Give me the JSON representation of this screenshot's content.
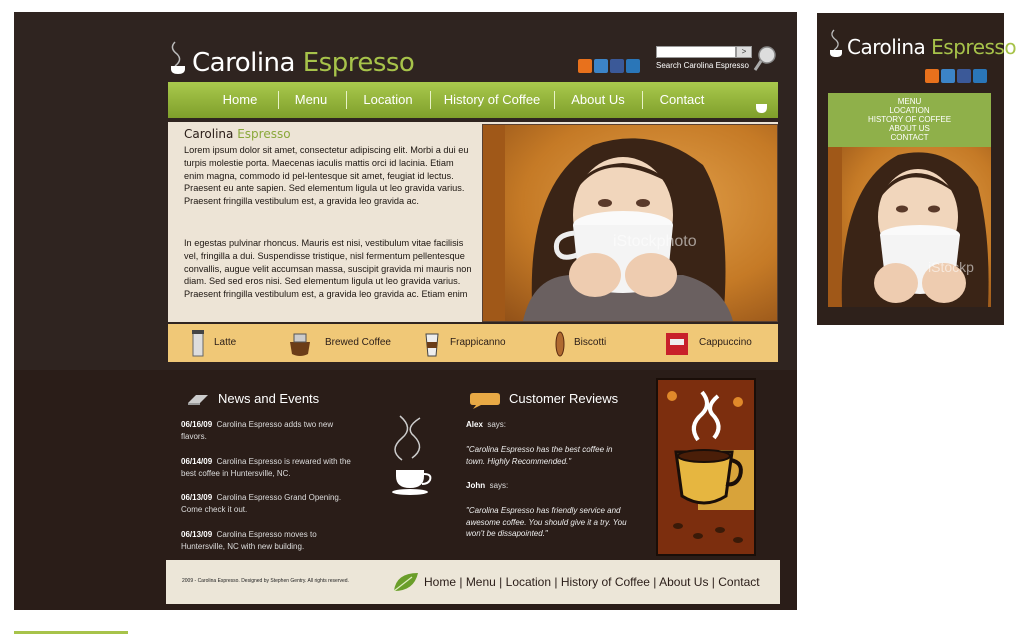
{
  "brand": {
    "name_white": "Carolina",
    "name_green": "Espresso"
  },
  "social": [
    {
      "name": "blogger",
      "color": "#e8711c"
    },
    {
      "name": "stumbleupon",
      "color": "#3c84c7"
    },
    {
      "name": "facebook",
      "color": "#3b5998"
    },
    {
      "name": "digg",
      "color": "#2a76b8"
    }
  ],
  "search": {
    "placeholder": "",
    "button": ">",
    "caption": "Search Carolina Espresso"
  },
  "nav": [
    "Home",
    "Menu",
    "Location",
    "History of Coffee",
    "About Us",
    "Contact"
  ],
  "intro": {
    "title_a": "Carolina",
    "title_b": "Espresso",
    "p1": "Lorem ipsum dolor sit amet, consectetur adipiscing elit. Morbi a dui eu turpis molestie porta. Maecenas iaculis mattis orci id lacinia. Etiam enim magna, commodo id pel-lentesque sit amet, feugiat id lectus. Praesent eu ante sapien. Sed elementum ligula ut leo gravida varius. Praesent fringilla vestibulum est, a gravida leo gravida ac.",
    "p2": "In egestas pulvinar rhoncus. Mauris est nisi, vestibulum vitae facilisis vel, fringilla a dui. Suspendisse tristique, nisl fermentum pellentesque convallis, augue velit accumsan massa, suscipit gravida mi mauris non diam. Sed sed eros nisi.  Sed elementum ligula ut leo gravida varius. Praesent fringilla vestibulum est, a gravida leo gravida ac.  Etiam enim"
  },
  "watermark": "iStockphoto",
  "products": [
    "Latte",
    "Brewed Coffee",
    "Frappicanno",
    "Biscotti",
    "Cappuccino"
  ],
  "news": {
    "title": "News and Events",
    "items": [
      {
        "date": "06/16/09",
        "text": "Carolina Espresso adds two new flavors."
      },
      {
        "date": "06/14/09",
        "text": "Carolina Espresso is rewared with the best coffee in Huntersville, NC."
      },
      {
        "date": "06/13/09",
        "text": "Carolina Espresso Grand Opening. Come check it out."
      },
      {
        "date": "06/13/09",
        "text": "Carolina Espresso moves to Huntersville, NC with new building."
      }
    ]
  },
  "reviews": {
    "title": "Customer Reviews",
    "items": [
      {
        "name": "Alex",
        "says": "says:",
        "quote": "\"Carolina Espresso has the best coffee in town.  Highly Recommended.\""
      },
      {
        "name": "John",
        "says": "says:",
        "quote": "\"Carolina Espresso has friendly service and awesome coffee. You should give it a try.  You won't be dissapointed.\""
      }
    ]
  },
  "footer": {
    "copyright": "2009 - Carolina Espresso. Designed by Stephen Gentry.  All rights reserved.",
    "links": [
      "Home",
      "Menu",
      "Location",
      "History of Coffee",
      "About Us",
      "Contact"
    ]
  },
  "mobile": {
    "name_white": "Carolina",
    "name_green": "Espresso",
    "menu": [
      "MENU",
      "LOCATION",
      "HISTORY OF COFFEE",
      "ABOUT US",
      "CONTACT"
    ],
    "watermark": "iStockp"
  },
  "colors": {
    "accent": "#a7c34a",
    "dark": "#2f2420",
    "cream": "#ede4d6",
    "strip": "#f0c877"
  }
}
